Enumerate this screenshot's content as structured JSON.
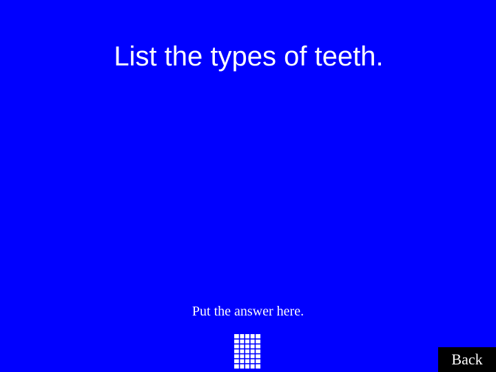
{
  "slide": {
    "background_color": "#0000ff",
    "question": "List the types of teeth.",
    "answer_placeholder": "Put the answer here.",
    "back_label": "Back"
  },
  "icons": {
    "grid": "grid-icon"
  }
}
